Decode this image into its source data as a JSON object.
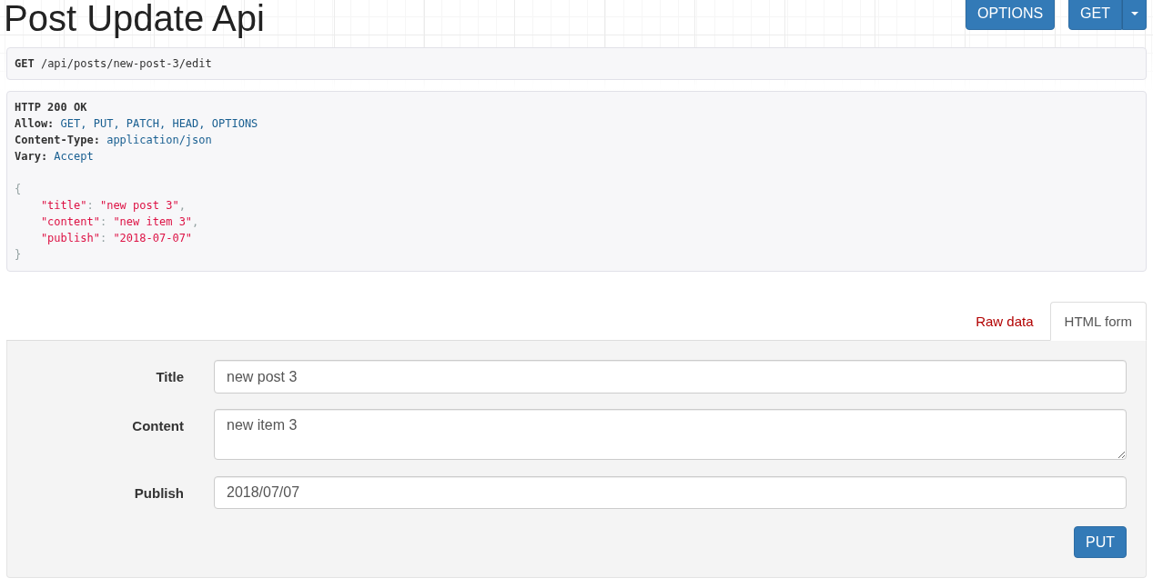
{
  "page": {
    "title": "Post Update Api"
  },
  "actions": [
    {
      "kind": "button",
      "label": "OPTIONS"
    },
    {
      "kind": "split",
      "label": "GET"
    }
  ],
  "request": "**GET** /api/posts/new-post-3/edit",
  "response": {
    "status": "HTTP 200 OK",
    "headers": [
      {
        "name": "Allow:",
        "value": "GET, PUT, PATCH, HEAD, OPTIONS"
      },
      {
        "name": "Content-Type:",
        "value": "application/json"
      },
      {
        "name": "Vary:",
        "value": "Accept"
      }
    ],
    "body": {
      "open": "{",
      "members": [
        {
          "key": "\"title\"",
          "colon": ":",
          "value": "\"new post 3\"",
          "comma": ","
        },
        {
          "key": "\"content\"",
          "colon": ":",
          "value": "\"new item 3\"",
          "comma": ","
        },
        {
          "key": "\"publish\"",
          "colon": ":",
          "value": "\"2018-07-07\""
        }
      ],
      "close": "}"
    }
  },
  "tabs": [
    {
      "label": "Raw data",
      "selected": false
    },
    {
      "label": "HTML form",
      "selected": true
    }
  ],
  "form": {
    "fields": [
      {
        "kind": "text",
        "label": "Title",
        "value": "new post 3"
      },
      {
        "kind": "textarea",
        "label": "Content",
        "value": "new item 3"
      },
      {
        "kind": "date",
        "label": "Publish",
        "value": "2018/07/07"
      }
    ],
    "submit": "PUT"
  }
}
